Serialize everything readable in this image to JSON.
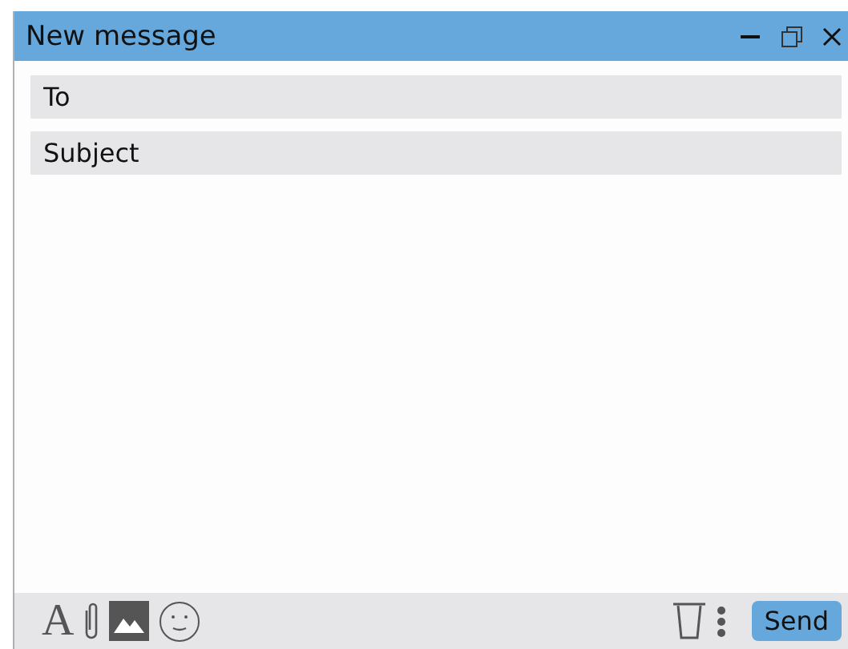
{
  "window": {
    "title": "New message"
  },
  "fields": [
    {
      "placeholder": "To"
    },
    {
      "placeholder": "Subject"
    }
  ],
  "toolbar": {
    "format_glyph": "A",
    "send_label": "Send"
  }
}
